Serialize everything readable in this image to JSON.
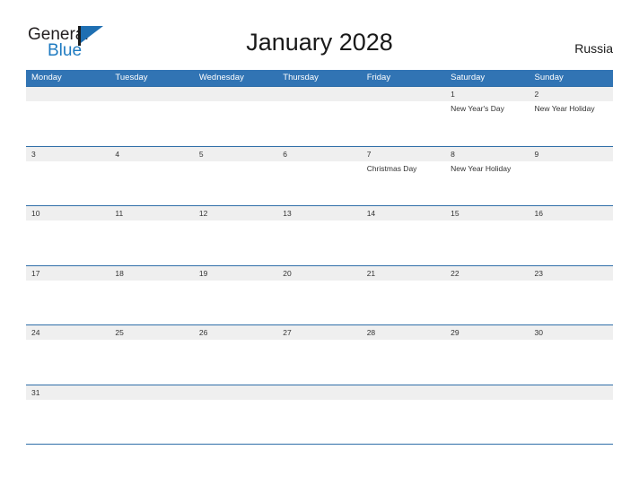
{
  "brand": {
    "logo_text_top": "General",
    "logo_text_bottom": "Blue",
    "logo_flag_icon": "flag-triangle-icon",
    "accent_color": "#1f7bc1"
  },
  "header": {
    "title": "January 2028",
    "country": "Russia"
  },
  "colors": {
    "header_blue": "#3174b4",
    "row_rule_blue": "#2f6ea8",
    "date_band_gray": "#efefef",
    "text": "#333333"
  },
  "calendar": {
    "weekdays": [
      "Monday",
      "Tuesday",
      "Wednesday",
      "Thursday",
      "Friday",
      "Saturday",
      "Sunday"
    ],
    "weeks": [
      [
        {
          "day": "",
          "event": ""
        },
        {
          "day": "",
          "event": ""
        },
        {
          "day": "",
          "event": ""
        },
        {
          "day": "",
          "event": ""
        },
        {
          "day": "",
          "event": ""
        },
        {
          "day": "1",
          "event": "New Year's Day"
        },
        {
          "day": "2",
          "event": "New Year Holiday"
        }
      ],
      [
        {
          "day": "3",
          "event": ""
        },
        {
          "day": "4",
          "event": ""
        },
        {
          "day": "5",
          "event": ""
        },
        {
          "day": "6",
          "event": ""
        },
        {
          "day": "7",
          "event": "Christmas Day"
        },
        {
          "day": "8",
          "event": "New Year Holiday"
        },
        {
          "day": "9",
          "event": ""
        }
      ],
      [
        {
          "day": "10",
          "event": ""
        },
        {
          "day": "11",
          "event": ""
        },
        {
          "day": "12",
          "event": ""
        },
        {
          "day": "13",
          "event": ""
        },
        {
          "day": "14",
          "event": ""
        },
        {
          "day": "15",
          "event": ""
        },
        {
          "day": "16",
          "event": ""
        }
      ],
      [
        {
          "day": "17",
          "event": ""
        },
        {
          "day": "18",
          "event": ""
        },
        {
          "day": "19",
          "event": ""
        },
        {
          "day": "20",
          "event": ""
        },
        {
          "day": "21",
          "event": ""
        },
        {
          "day": "22",
          "event": ""
        },
        {
          "day": "23",
          "event": ""
        }
      ],
      [
        {
          "day": "24",
          "event": ""
        },
        {
          "day": "25",
          "event": ""
        },
        {
          "day": "26",
          "event": ""
        },
        {
          "day": "27",
          "event": ""
        },
        {
          "day": "28",
          "event": ""
        },
        {
          "day": "29",
          "event": ""
        },
        {
          "day": "30",
          "event": ""
        }
      ],
      [
        {
          "day": "31",
          "event": ""
        },
        {
          "day": "",
          "event": ""
        },
        {
          "day": "",
          "event": ""
        },
        {
          "day": "",
          "event": ""
        },
        {
          "day": "",
          "event": ""
        },
        {
          "day": "",
          "event": ""
        },
        {
          "day": "",
          "event": ""
        }
      ]
    ]
  }
}
